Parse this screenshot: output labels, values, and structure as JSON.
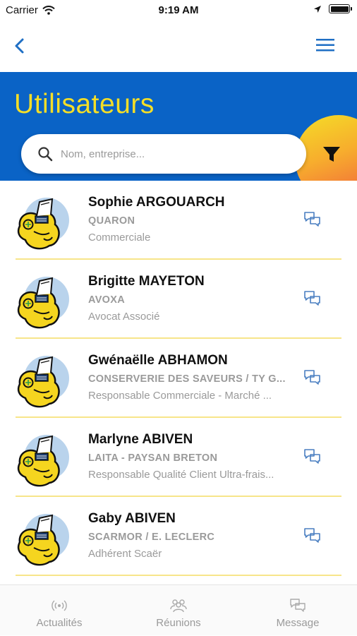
{
  "status_bar": {
    "carrier": "Carrier",
    "time": "9:19 AM"
  },
  "nav": {
    "back_icon": "chevron-left-icon",
    "menu_icon": "hamburger-menu-icon"
  },
  "header": {
    "title": "Utilisateurs",
    "search_placeholder": "Nom, entreprise...",
    "filter_icon": "filter-funnel-icon"
  },
  "colors": {
    "header_blue": "#0a63c6",
    "title_yellow": "#f4de27",
    "accent_blue": "#1f6fc4",
    "separator_yellow": "#f7e58a"
  },
  "users": [
    {
      "name": "Sophie ARGOUARCH",
      "company": "QUARON",
      "role": "Commerciale"
    },
    {
      "name": "Brigitte MAYETON",
      "company": "AVOXA",
      "role": "Avocat Associé"
    },
    {
      "name": "Gwénaëlle ABHAMON",
      "company": "CONSERVERIE DES SAVEURS / TY G...",
      "role": "Responsable Commerciale - Marché ..."
    },
    {
      "name": "Marlyne ABIVEN",
      "company": "LAITA - PAYSAN BRETON",
      "role": "Responsable Qualité Client Ultra-frais..."
    },
    {
      "name": "Gaby ABIVEN",
      "company": "SCARMOR / E. LECLERC",
      "role": "Adhérent Scaër"
    }
  ],
  "tabs": [
    {
      "label": "Actualités",
      "icon": "broadcast-icon"
    },
    {
      "label": "Réunions",
      "icon": "people-group-icon"
    },
    {
      "label": "Message",
      "icon": "chat-bubbles-icon"
    }
  ]
}
